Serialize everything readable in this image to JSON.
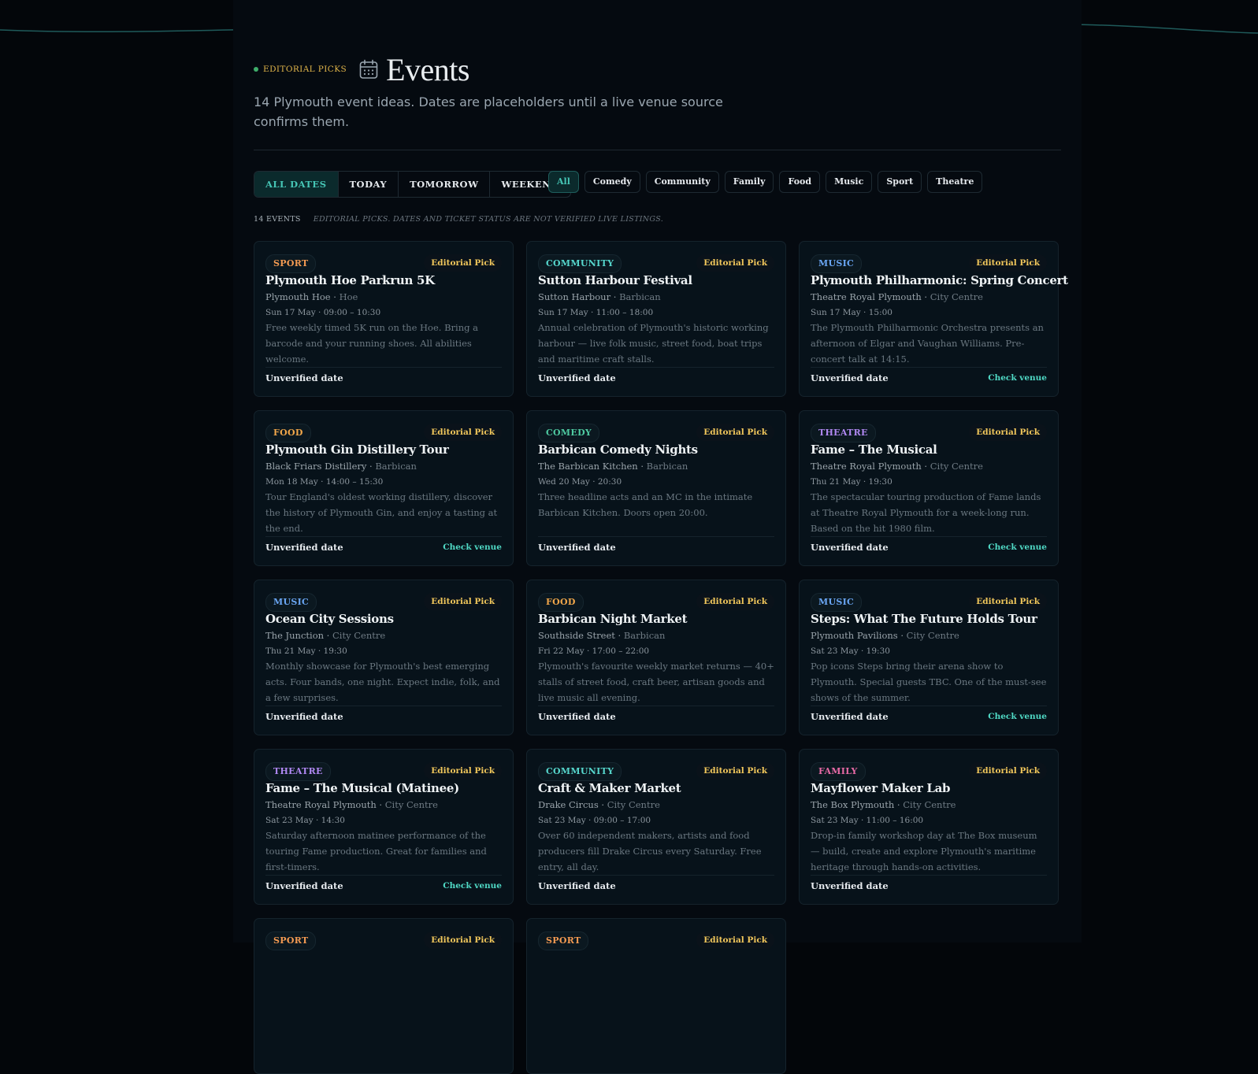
{
  "header": {
    "kicker": "EDITORIAL PICKS",
    "title": "Events",
    "subtitle": "14 Plymouth event ideas. Dates are placeholders until a live venue source confirms them."
  },
  "date_filters": [
    {
      "label": "ALL DATES",
      "active": true
    },
    {
      "label": "TODAY",
      "active": false
    },
    {
      "label": "TOMORROW",
      "active": false
    },
    {
      "label": "WEEKEND",
      "active": false
    }
  ],
  "category_filters": [
    {
      "label": "All",
      "active": true
    },
    {
      "label": "Comedy",
      "active": false
    },
    {
      "label": "Community",
      "active": false
    },
    {
      "label": "Family",
      "active": false
    },
    {
      "label": "Food",
      "active": false
    },
    {
      "label": "Music",
      "active": false
    },
    {
      "label": "Sport",
      "active": false
    },
    {
      "label": "Theatre",
      "active": false
    }
  ],
  "summary": {
    "count": "14 EVENTS",
    "note": "EDITORIAL PICKS. DATES AND TICKET STATUS ARE NOT VERIFIED LIVE LISTINGS."
  },
  "colors": {
    "accent": "#46c6b6",
    "pick": "#f0c65b",
    "sport": "#f39a52",
    "community": "#56d6cc",
    "music": "#6aa6f4",
    "food": "#f0a64a",
    "comedy": "#4ec9a0",
    "theatre": "#b088f2",
    "family": "#e86aa6"
  },
  "icons": {
    "title_icon": "calendar-icon"
  },
  "events": [
    {
      "tag": "SPORT",
      "type": "sport",
      "pick": "Editorial Pick",
      "title": "Plymouth Hoe Parkrun 5K",
      "venue": "Plymouth Hoe",
      "area": "Hoe",
      "when": "Sun 17 May · 09:00 – 10:30",
      "desc": "Free weekly timed 5K run on the Hoe. Bring a barcode and your running shoes. All abilities welcome.",
      "status": "Unverified date",
      "check": ""
    },
    {
      "tag": "COMMUNITY",
      "type": "community",
      "pick": "Editorial Pick",
      "title": "Sutton Harbour Festival",
      "venue": "Sutton Harbour",
      "area": "Barbican",
      "when": "Sun 17 May · 11:00 – 18:00",
      "desc": "Annual celebration of Plymouth's historic working harbour — live folk music, street food, boat trips and maritime craft stalls.",
      "status": "Unverified date",
      "check": ""
    },
    {
      "tag": "MUSIC",
      "type": "music",
      "pick": "Editorial Pick",
      "title": "Plymouth Philharmonic: Spring Concert",
      "venue": "Theatre Royal Plymouth",
      "area": "City Centre",
      "when": "Sun 17 May · 15:00",
      "desc": "The Plymouth Philharmonic Orchestra presents an afternoon of Elgar and Vaughan Williams. Pre-concert talk at 14:15.",
      "status": "Unverified date",
      "check": "Check venue"
    },
    {
      "tag": "FOOD",
      "type": "food",
      "pick": "Editorial Pick",
      "title": "Plymouth Gin Distillery Tour",
      "venue": "Black Friars Distillery",
      "area": "Barbican",
      "when": "Mon 18 May · 14:00 – 15:30",
      "desc": "Tour England's oldest working distillery, discover the history of Plymouth Gin, and enjoy a tasting at the end.",
      "status": "Unverified date",
      "check": "Check venue"
    },
    {
      "tag": "COMEDY",
      "type": "comedy",
      "pick": "Editorial Pick",
      "title": "Barbican Comedy Nights",
      "venue": "The Barbican Kitchen",
      "area": "Barbican",
      "when": "Wed 20 May · 20:30",
      "desc": "Three headline acts and an MC in the intimate Barbican Kitchen. Doors open 20:00.",
      "status": "Unverified date",
      "check": ""
    },
    {
      "tag": "THEATRE",
      "type": "theatre",
      "pick": "Editorial Pick",
      "title": "Fame – The Musical",
      "venue": "Theatre Royal Plymouth",
      "area": "City Centre",
      "when": "Thu 21 May · 19:30",
      "desc": "The spectacular touring production of Fame lands at Theatre Royal Plymouth for a week-long run. Based on the hit 1980 film.",
      "status": "Unverified date",
      "check": "Check venue"
    },
    {
      "tag": "MUSIC",
      "type": "music",
      "pick": "Editorial Pick",
      "title": "Ocean City Sessions",
      "venue": "The Junction",
      "area": "City Centre",
      "when": "Thu 21 May · 19:30",
      "desc": "Monthly showcase for Plymouth's best emerging acts. Four bands, one night. Expect indie, folk, and a few surprises.",
      "status": "Unverified date",
      "check": ""
    },
    {
      "tag": "FOOD",
      "type": "food",
      "pick": "Editorial Pick",
      "title": "Barbican Night Market",
      "venue": "Southside Street",
      "area": "Barbican",
      "when": "Fri 22 May · 17:00 – 22:00",
      "desc": "Plymouth's favourite weekly market returns — 40+ stalls of street food, craft beer, artisan goods and live music all evening.",
      "status": "Unverified date",
      "check": ""
    },
    {
      "tag": "MUSIC",
      "type": "music",
      "pick": "Editorial Pick",
      "title": "Steps: What The Future Holds Tour",
      "venue": "Plymouth Pavilions",
      "area": "City Centre",
      "when": "Sat 23 May · 19:30",
      "desc": "Pop icons Steps bring their arena show to Plymouth. Special guests TBC. One of the must-see shows of the summer.",
      "status": "Unverified date",
      "check": "Check venue"
    },
    {
      "tag": "THEATRE",
      "type": "theatre",
      "pick": "Editorial Pick",
      "title": "Fame – The Musical (Matinee)",
      "venue": "Theatre Royal Plymouth",
      "area": "City Centre",
      "when": "Sat 23 May · 14:30",
      "desc": "Saturday afternoon matinee performance of the touring Fame production. Great for families and first-timers.",
      "status": "Unverified date",
      "check": "Check venue"
    },
    {
      "tag": "COMMUNITY",
      "type": "community",
      "pick": "Editorial Pick",
      "title": "Craft & Maker Market",
      "venue": "Drake Circus",
      "area": "City Centre",
      "when": "Sat 23 May · 09:00 – 17:00",
      "desc": "Over 60 independent makers, artists and food producers fill Drake Circus every Saturday. Free entry, all day.",
      "status": "Unverified date",
      "check": ""
    },
    {
      "tag": "FAMILY",
      "type": "family",
      "pick": "Editorial Pick",
      "title": "Mayflower Maker Lab",
      "venue": "The Box Plymouth",
      "area": "City Centre",
      "when": "Sat 23 May · 11:00 – 16:00",
      "desc": "Drop-in family workshop day at The Box museum — build, create and explore Plymouth's maritime heritage through hands-on activities.",
      "status": "Unverified date",
      "check": ""
    },
    {
      "tag": "SPORT",
      "type": "sport",
      "pick": "Editorial Pick",
      "title": "",
      "venue": "",
      "area": "",
      "when": "",
      "desc": "",
      "status": "",
      "check": ""
    },
    {
      "tag": "SPORT",
      "type": "sport",
      "pick": "Editorial Pick",
      "title": "",
      "venue": "",
      "area": "",
      "when": "",
      "desc": "",
      "status": "",
      "check": ""
    }
  ]
}
